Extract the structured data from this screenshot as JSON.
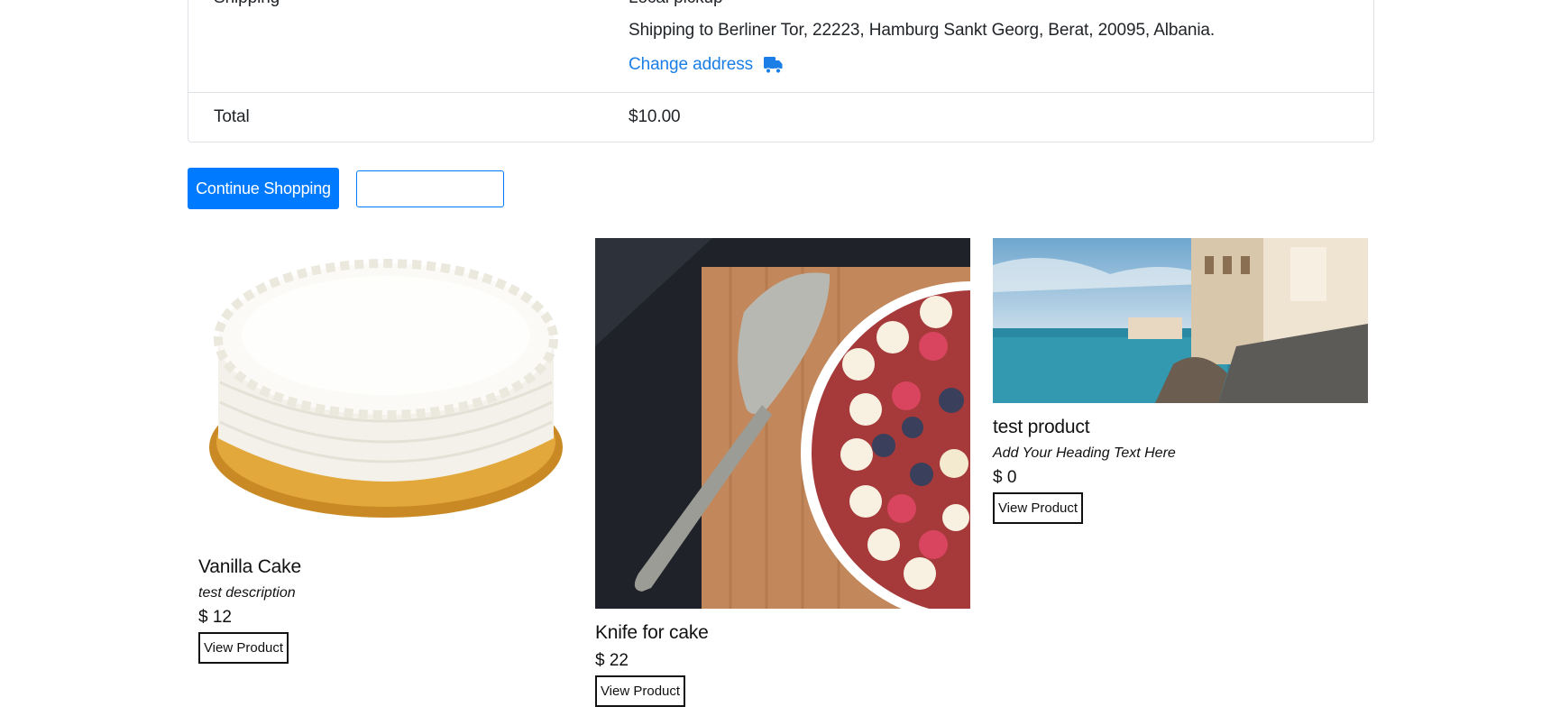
{
  "order_summary": {
    "shipping_label": "Shipping",
    "shipping_method": "Local pickup",
    "shipping_to": "Shipping to Berliner Tor, 22223, Hamburg Sankt Georg, Berat, 20095, Albania.",
    "change_address_label": "Change address",
    "total_label": "Total",
    "total_value": "$10.00"
  },
  "actions": {
    "continue_label": "Continue Shopping",
    "secondary_label": ""
  },
  "products": [
    {
      "title": "Vanilla Cake",
      "description": "test description",
      "price": "$ 12",
      "button": "View Product",
      "image": "vanilla-cake-photo"
    },
    {
      "title": "Knife for cake",
      "description": "",
      "price": "$ 22",
      "button": "View Product",
      "image": "cake-knife-photo"
    },
    {
      "title": "test product",
      "description": "Add Your Heading Text Here",
      "price": "$ 0",
      "button": "View Product",
      "image": "coastal-town-photo"
    }
  ],
  "icons": {
    "truck": "truck-icon"
  },
  "colors": {
    "accent": "#007bff",
    "link": "#1a7ee6",
    "border": "#dee2e6"
  }
}
